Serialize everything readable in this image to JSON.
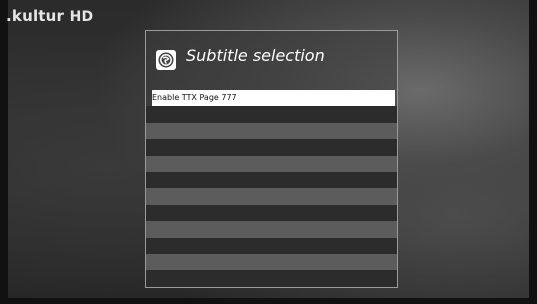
{
  "channel": {
    "name": ".kultur",
    "quality": "HD"
  },
  "dialog": {
    "title": "Subtitle selection",
    "icon": "subtitle-globe-icon",
    "items": [
      {
        "label": "Enable TTX Page 777",
        "selected": true
      }
    ]
  },
  "colors": {
    "selected_row": "#ffffff",
    "row_dark": "#2c2c2c",
    "row_light": "#5c5c5c",
    "title_text": "#ffffff"
  }
}
